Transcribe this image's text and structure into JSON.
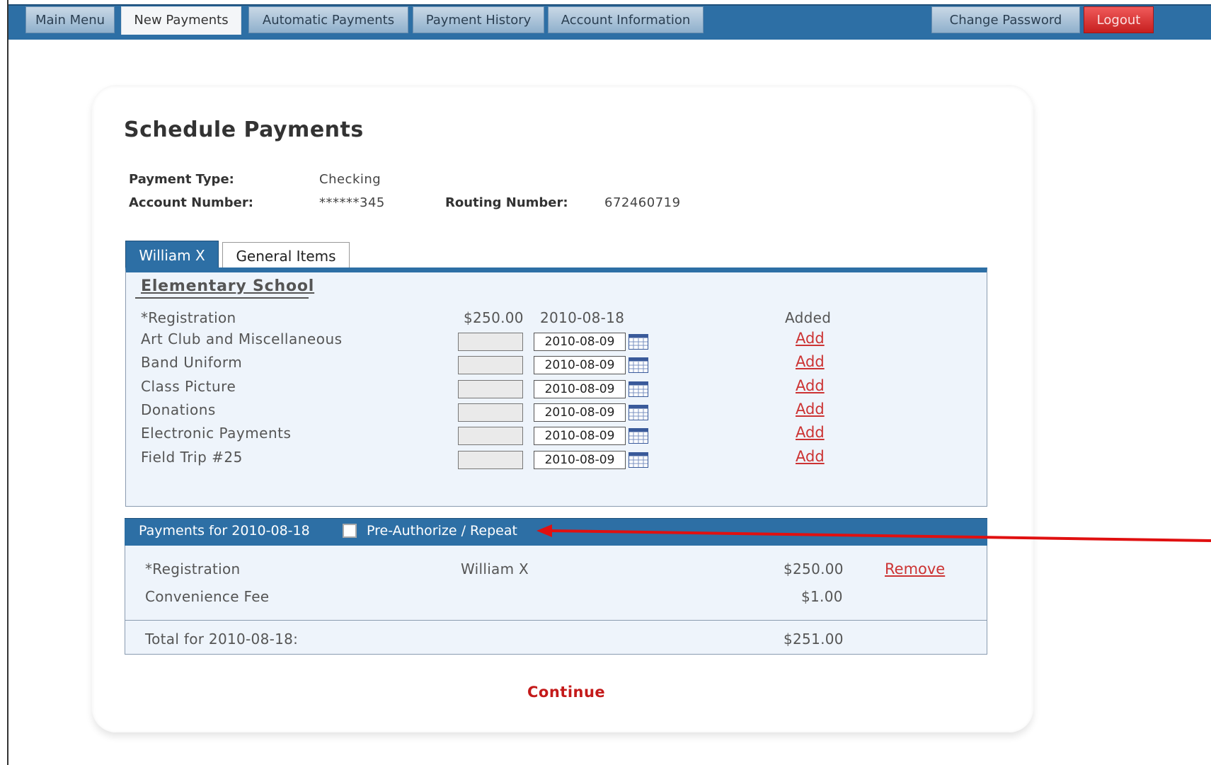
{
  "nav": {
    "tabs": [
      {
        "label": "Main Menu"
      },
      {
        "label": "New Payments"
      },
      {
        "label": "Automatic Payments"
      },
      {
        "label": "Payment History"
      },
      {
        "label": "Account Information"
      }
    ],
    "change_password": "Change Password",
    "logout": "Logout",
    "active_tab": "New Payments"
  },
  "page_title": "Schedule Payments",
  "account": {
    "payment_type_label": "Payment Type:",
    "payment_type_value": "Checking",
    "account_number_label": "Account Number:",
    "account_number_value": "******345",
    "routing_number_label": "Routing Number:",
    "routing_number_value": "672460719"
  },
  "student_tabs": {
    "student": "William X",
    "general": "General Items"
  },
  "school": "Elementary School",
  "registration": {
    "name": "*Registration",
    "amount": "$250.00",
    "date": "2010-08-18",
    "status": "Added"
  },
  "items": [
    {
      "name": "Art Club and Miscellaneous",
      "amount": "",
      "date": "2010-08-09",
      "action": "Add"
    },
    {
      "name": "Band Uniform",
      "amount": "",
      "date": "2010-08-09",
      "action": "Add"
    },
    {
      "name": "Class Picture",
      "amount": "",
      "date": "2010-08-09",
      "action": "Add"
    },
    {
      "name": "Donations",
      "amount": "",
      "date": "2010-08-09",
      "action": "Add"
    },
    {
      "name": "Electronic Payments",
      "amount": "",
      "date": "2010-08-09",
      "action": "Add"
    },
    {
      "name": "Field Trip #25",
      "amount": "",
      "date": "2010-08-09",
      "action": "Add"
    }
  ],
  "payments": {
    "header": "Payments for 2010-08-18",
    "preauth_label": "Pre-Authorize / Repeat",
    "preauth_checked": false,
    "rows": [
      {
        "name": "*Registration",
        "student": "William X",
        "amount": "$250.00",
        "action": "Remove"
      },
      {
        "name": "Convenience Fee",
        "student": "",
        "amount": "$1.00",
        "action": ""
      }
    ],
    "total_label": "Total for 2010-08-18:",
    "total_amount": "$251.00"
  },
  "continue": "Continue",
  "colors": {
    "nav_blue": "#2d6fa5",
    "link_red": "#c33",
    "annotation_arrow": "#e01010"
  }
}
